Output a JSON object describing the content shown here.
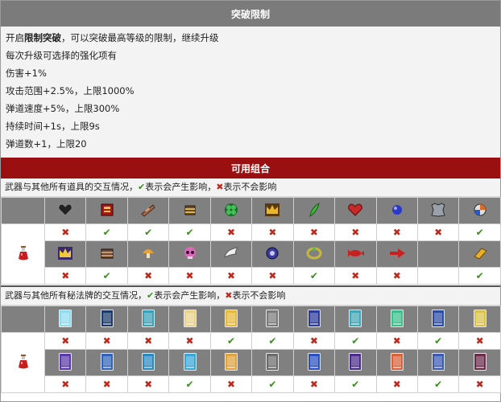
{
  "breakthrough": {
    "header": "突破限制",
    "lines": {
      "l1_pre": "开启",
      "l1_bold": "限制突破",
      "l1_post": "，可以突破最高等级的限制，继续升级",
      "l2": "每次升级可选择的强化项有",
      "l3": "伤害+1%",
      "l4": "攻击范围+2.5%，上限1000%",
      "l5": "弹道速度+5%，上限300%",
      "l6": "持续时间+1s，上限9s",
      "l7": "弹道数+1，上限20"
    }
  },
  "combos": {
    "header": "可用组合",
    "items_note": {
      "prefix": "武器与其他所有道具的交互情况，",
      "check_mark": "✔",
      "check_text": "表示会产生影响，",
      "cross_mark": "✖",
      "cross_text": "表示不会影响"
    },
    "arcana_note": {
      "prefix": "武器与其他所有秘法牌的交互情况，",
      "check_mark": "✔",
      "check_text": "表示会产生影响，",
      "cross_mark": "✖",
      "cross_text": "表示不会影响"
    },
    "weapon_icon": "red-potion-icon",
    "items_row1": [
      {
        "icon": "black-heart-icon",
        "mark": "✖",
        "affects": false
      },
      {
        "icon": "red-tome-icon",
        "mark": "✔",
        "affects": true
      },
      {
        "icon": "candelabrador-icon",
        "mark": "✔",
        "affects": true
      },
      {
        "icon": "bracer-icon",
        "mark": "✔",
        "affects": true
      },
      {
        "icon": "clover-icon",
        "mark": "✖",
        "affects": false
      },
      {
        "icon": "crown-icon",
        "mark": "✖",
        "affects": false
      },
      {
        "icon": "feather-icon",
        "mark": "✖",
        "affects": false
      },
      {
        "icon": "heart-icon",
        "mark": "✖",
        "affects": false
      },
      {
        "icon": "orb-icon",
        "mark": "✖",
        "affects": false
      },
      {
        "icon": "armor-icon",
        "mark": "✖",
        "affects": false
      },
      {
        "icon": "duplicator-icon",
        "mark": "✔",
        "affects": true
      }
    ],
    "items_row2": [
      {
        "icon": "golden-crown-icon",
        "mark": "✖",
        "affects": false
      },
      {
        "icon": "spellbinder-icon",
        "mark": "✔",
        "affects": true
      },
      {
        "icon": "mushroom-icon",
        "mark": "✖",
        "affects": false
      },
      {
        "icon": "skull-icon",
        "mark": "✖",
        "affects": false
      },
      {
        "icon": "wings-icon",
        "mark": "✖",
        "affects": false
      },
      {
        "icon": "attractorb-icon",
        "mark": "✖",
        "affects": false
      },
      {
        "icon": "ring-icon",
        "mark": "✔",
        "affects": true
      },
      {
        "icon": "red-fish-icon",
        "mark": "✖",
        "affects": false
      },
      {
        "icon": "red-arrow-icon",
        "mark": "✖",
        "affects": false
      },
      {
        "icon": "empty-icon",
        "mark": "",
        "affects": false
      },
      {
        "icon": "gold-bar-icon",
        "mark": "✔",
        "affects": true
      }
    ],
    "arcana_row1": [
      {
        "icon": "arcana-card-1-icon",
        "color": "#8fdcf0",
        "mark": "✖",
        "affects": false
      },
      {
        "icon": "arcana-card-2-icon",
        "color": "#1a3a6a",
        "mark": "✖",
        "affects": false
      },
      {
        "icon": "arcana-card-3-icon",
        "color": "#3aa0b8",
        "mark": "✖",
        "affects": false
      },
      {
        "icon": "arcana-card-4-icon",
        "color": "#e8d28a",
        "mark": "✖",
        "affects": false
      },
      {
        "icon": "arcana-card-5-icon",
        "color": "#e7b93a",
        "mark": "✔",
        "affects": true
      },
      {
        "icon": "arcana-card-6-icon",
        "color": "#7a7a7a",
        "mark": "✔",
        "affects": true
      },
      {
        "icon": "arcana-card-7-icon",
        "color": "#2a3a9a",
        "mark": "✖",
        "affects": false
      },
      {
        "icon": "arcana-card-8-icon",
        "color": "#3fa7b8",
        "mark": "✔",
        "affects": true
      },
      {
        "icon": "arcana-card-9-icon",
        "color": "#3bbf8a",
        "mark": "✖",
        "affects": false
      },
      {
        "icon": "arcana-card-10-icon",
        "color": "#2c4ca4",
        "mark": "✔",
        "affects": true
      },
      {
        "icon": "arcana-card-11-icon",
        "color": "#d9c24a",
        "mark": "✖",
        "affects": false
      }
    ],
    "arcana_row2": [
      {
        "icon": "arcana-card-12-icon",
        "color": "#5a3aa8",
        "mark": "✖",
        "affects": false
      },
      {
        "icon": "arcana-card-13-icon",
        "color": "#2f63b8",
        "mark": "✖",
        "affects": false
      },
      {
        "icon": "arcana-card-14-icon",
        "color": "#2a8ac0",
        "mark": "✖",
        "affects": false
      },
      {
        "icon": "arcana-card-15-icon",
        "color": "#3aa6d8",
        "mark": "✔",
        "affects": true
      },
      {
        "icon": "arcana-card-16-icon",
        "color": "#e0a23a",
        "mark": "✖",
        "affects": false
      },
      {
        "icon": "arcana-card-17-icon",
        "color": "#6a6a6a",
        "mark": "✔",
        "affects": true
      },
      {
        "icon": "arcana-card-18-icon",
        "color": "#2a4fc0",
        "mark": "✖",
        "affects": false
      },
      {
        "icon": "arcana-card-19-icon",
        "color": "#4a2a8a",
        "mark": "✔",
        "affects": true
      },
      {
        "icon": "arcana-card-20-icon",
        "color": "#d8623a",
        "mark": "✖",
        "affects": false
      },
      {
        "icon": "arcana-card-21-icon",
        "color": "#3a5ab0",
        "mark": "✔",
        "affects": true
      },
      {
        "icon": "arcana-card-22-icon",
        "color": "#6a2a4a",
        "mark": "✖",
        "affects": false
      }
    ]
  }
}
